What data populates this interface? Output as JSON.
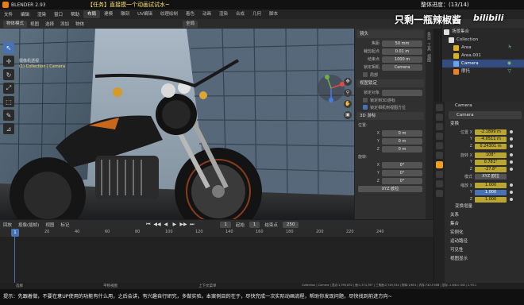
{
  "titlebar": {
    "app_name": "BLENDER 2.93",
    "task_text": "【任务】直接摸一个动画试试水~",
    "progress": "整体进度：(13/14)"
  },
  "overlay": {
    "banner": "只剩一瓶辣椒酱",
    "watermark": "bilibili"
  },
  "menubar": {
    "menus": [
      "文件",
      "编辑",
      "渲染",
      "窗口",
      "帮助"
    ],
    "workspaces": [
      "布局",
      "建模",
      "雕刻",
      "UV编辑",
      "纹理绘制",
      "着色",
      "动画",
      "渲染",
      "合成",
      "几何",
      "脚本"
    ],
    "active_workspace": "布局"
  },
  "viewport_header": {
    "mode": "物体模式",
    "items": [
      "视图",
      "选择",
      "添加",
      "物体"
    ],
    "orientation": "全局"
  },
  "viewport_info": {
    "line1": "摄像机透视",
    "line2": "(1) Collection | Camera"
  },
  "nav_buttons": [
    "✥",
    "⚲",
    "✋",
    "▣"
  ],
  "tools": [
    "↖",
    "✛",
    "↻",
    "⤢",
    "⬚",
    "✎",
    "⊿"
  ],
  "npanel": {
    "lens_label": "镜头",
    "rows": [
      {
        "k": "焦距",
        "v": "50 mm"
      },
      {
        "k": "裁剪起点",
        "v": "0.01 m"
      },
      {
        "k": "结束点",
        "v": "1000 m"
      }
    ],
    "lock_label": "锁定相机",
    "lock_value": "Camera",
    "local_label": "局部",
    "view_lock": "视图锁定",
    "lock_to_object": "锁定对象",
    "lock_to_3d_cursor": "锁定到3D游标",
    "lock_camera_to_view": "锁定相机到视图方位",
    "cursor_section": "3D 游标",
    "location_label": "位置:",
    "cursor_loc": [
      {
        "k": "X",
        "v": "0 m"
      },
      {
        "k": "Y",
        "v": "0 m"
      },
      {
        "k": "Z",
        "v": "0 m"
      }
    ],
    "rotation_label": "旋转:",
    "cursor_rot": [
      {
        "k": "X",
        "v": "0°"
      },
      {
        "k": "Y",
        "v": "0°"
      },
      {
        "k": "Z",
        "v": "0°"
      }
    ],
    "rotation_mode": "XYZ 欧拉",
    "tabs": [
      "条目",
      "工具",
      "视图"
    ]
  },
  "timeline": {
    "header_items": [
      "回放",
      "抠像(插帧)",
      "视图",
      "标记"
    ],
    "current_frame": "1",
    "start_label": "起始",
    "start": "1",
    "end_label": "结束点",
    "end": "250",
    "ruler": [
      "0",
      "20",
      "40",
      "60",
      "80",
      "100",
      "120",
      "140",
      "160",
      "180",
      "200",
      "220",
      "240"
    ],
    "transport": [
      "⏮",
      "◀◀",
      "◀",
      "▶",
      "▶▶",
      "⏭"
    ]
  },
  "outliner": {
    "items": [
      {
        "label": "场景集合",
        "indent": 2,
        "color": "#e0e0e0",
        "selected": false,
        "ext": ""
      },
      {
        "label": "Collection",
        "indent": 8,
        "color": "#e0e0e0",
        "selected": false,
        "ext": ""
      },
      {
        "label": "Area",
        "indent": 14,
        "color": "#d8b020",
        "selected": false,
        "ext": "Ϟ"
      },
      {
        "label": "Area.001",
        "indent": 14,
        "color": "#d8b020",
        "selected": false,
        "ext": ""
      },
      {
        "label": "Camera",
        "indent": 14,
        "color": "#6fa3e0",
        "selected": true,
        "ext": "◉"
      },
      {
        "label": "摩托",
        "indent": 14,
        "color": "#f08020",
        "selected": false,
        "ext": "▽"
      }
    ]
  },
  "properties": {
    "object_name_top": "Camera",
    "object_name": "Camera",
    "transform_section": "变换",
    "location_label": "位置 X",
    "location": [
      {
        "k": "位置 X",
        "v": "-2.1899 m",
        "style": "key"
      },
      {
        "k": "Y",
        "v": "-4.0511 m",
        "style": "key"
      },
      {
        "k": "Z",
        "v": "0.24301 m",
        "style": "key"
      }
    ],
    "rotation": [
      {
        "k": "旋转 X",
        "v": "108°",
        "style": "key"
      },
      {
        "k": "Y",
        "v": "0.781°",
        "style": "key"
      },
      {
        "k": "Z",
        "v": "-27.8°",
        "style": "key"
      }
    ],
    "rot_mode_label": "模式",
    "rot_mode": "XYZ 欧拉",
    "scale": [
      {
        "k": "缩放 X",
        "v": "1.000",
        "style": "key"
      },
      {
        "k": "Y",
        "v": "1.000",
        "style": "blue"
      },
      {
        "k": "Z",
        "v": "1.000",
        "style": "key"
      }
    ],
    "subsections": [
      "变换增量",
      "关系",
      "集合",
      "实例化",
      "运动路径",
      "可见性",
      "视图显示"
    ]
  },
  "statusbar": {
    "left": "选择",
    "middle1": "平移视图",
    "middle2": "上下文菜单",
    "right": "Collection | Camera | 顶点:1,395,632 | 面:1,374,767 | 三角面:2,749,534 | 物体:1/651 | 内存:740.5 MiB | 显存: 2.8/8.0 GiB | 2.93.1"
  },
  "subtitle": "提示：先跟着做，不要在意UP使用的功能有什么用，之后会讲，有兴趣自行研究，多做实验。本案例目的在于，尽快完成一次实际动画流程，帮助你发现问题，尽快找到前进方向~",
  "colors": {
    "accent_blue": "#4772b3",
    "keyframe_yellow": "#b9a531",
    "task_yellow": "#ffe36e"
  }
}
